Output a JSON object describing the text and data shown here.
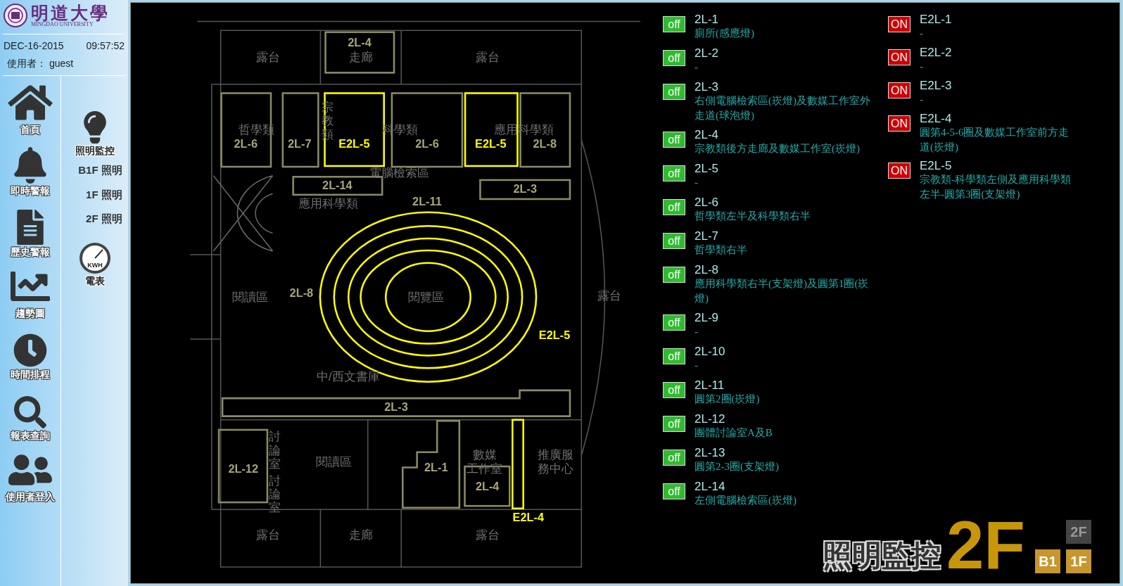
{
  "sidebar": {
    "logo_text": "明道大學",
    "logo_subtitle": "MINGDAO UNIVERSITY",
    "date": "DEC-16-2015",
    "time": "09:57:52",
    "user_label": "使用者：",
    "user": "guest",
    "nav": [
      {
        "label": "首頁",
        "kind": "home"
      },
      {
        "label": "即時警報",
        "kind": "alarm"
      },
      {
        "label": "歷史警報",
        "kind": "history"
      },
      {
        "label": "趨勢圖",
        "kind": "trend"
      },
      {
        "label": "時間排程",
        "kind": "schedule"
      },
      {
        "label": "報表查詢",
        "kind": "report"
      },
      {
        "label": "使用者登入",
        "kind": "users"
      }
    ],
    "lighting": {
      "title": "照明監控",
      "items": [
        "B1F 照明",
        "1F 照明",
        "2F 照明"
      ]
    },
    "meter": {
      "label": "電表",
      "dial": "KWH"
    }
  },
  "plan": {
    "rooms": [
      {
        "lines": [
          "露台"
        ],
        "kind": "h"
      },
      {
        "lines": [
          "走廊"
        ],
        "kind": "h"
      },
      {
        "lines": [
          "露台"
        ],
        "kind": "h"
      },
      {
        "lines": [
          "哲學類"
        ],
        "kind": "h"
      },
      {
        "lines": [
          "宗教類"
        ],
        "kind": "v"
      },
      {
        "lines": [
          "科學類"
        ],
        "kind": "h"
      },
      {
        "lines": [
          "應用科學類"
        ],
        "kind": "h"
      },
      {
        "lines": [
          "電腦檢索區"
        ],
        "kind": "h"
      },
      {
        "lines": [
          "應用科學類"
        ],
        "kind": "h"
      },
      {
        "lines": [
          "閱讀區"
        ],
        "kind": "h"
      },
      {
        "lines": [
          "閱覽區"
        ],
        "kind": "h"
      },
      {
        "lines": [
          "露台"
        ],
        "kind": "h"
      },
      {
        "lines": [
          "中/西文書庫"
        ],
        "kind": "h"
      },
      {
        "lines": [
          "討論室"
        ],
        "kind": "v"
      },
      {
        "lines": [
          "討論室"
        ],
        "kind": "v"
      },
      {
        "lines": [
          "閱讀區"
        ],
        "kind": "h"
      },
      {
        "lines": [
          "數媒",
          "工作室"
        ],
        "kind": "h"
      },
      {
        "lines": [
          "推廣服",
          "務中心"
        ],
        "kind": "h"
      },
      {
        "lines": [
          "露台"
        ],
        "kind": "h"
      },
      {
        "lines": [
          "走廊"
        ],
        "kind": "h"
      },
      {
        "lines": [
          "露台"
        ],
        "kind": "h"
      }
    ],
    "zones": [
      {
        "label": "2L-4",
        "lit": false
      },
      {
        "label": "2L-6",
        "lit": false
      },
      {
        "label": "2L-7",
        "lit": false
      },
      {
        "label": "E2L-5",
        "lit": true
      },
      {
        "label": "2L-6",
        "lit": false
      },
      {
        "label": "E2L-5",
        "lit": true
      },
      {
        "label": "2L-8",
        "lit": false
      },
      {
        "label": "2L-14",
        "lit": false
      },
      {
        "label": "2L-3",
        "lit": false
      },
      {
        "label": "2L-11",
        "lit": false
      },
      {
        "label": "2L-8",
        "lit": false
      },
      {
        "label": "E2L-5",
        "lit": true
      },
      {
        "label": "2L-3",
        "lit": false
      },
      {
        "label": "2L-12",
        "lit": false
      },
      {
        "label": "2L-1",
        "lit": false
      },
      {
        "label": "2L-4",
        "lit": false
      },
      {
        "label": "E2L-4",
        "lit": true
      }
    ],
    "rings": [
      {
        "lit": true
      },
      {
        "lit": true
      },
      {
        "lit": true
      },
      {
        "lit": true
      },
      {
        "lit": true
      }
    ]
  },
  "circuits": [
    [
      {
        "id": "2L-1",
        "description": "廁所(感應燈)",
        "status": "off",
        "on": false
      },
      {
        "id": "2L-2",
        "description": "-",
        "status": "off",
        "on": false
      },
      {
        "id": "2L-3",
        "description": "右側電腦檢索區(崁燈)及數媒工作室外走道(球泡燈)",
        "status": "off",
        "on": false
      },
      {
        "id": "2L-4",
        "description": "宗教類後方走廊及數媒工作室(崁燈)",
        "status": "off",
        "on": false
      },
      {
        "id": "2L-5",
        "description": "-",
        "status": "off",
        "on": false
      },
      {
        "id": "2L-6",
        "description": "哲學類左半及科學類右半",
        "status": "off",
        "on": false
      },
      {
        "id": "2L-7",
        "description": "哲學類右半",
        "status": "off",
        "on": false
      },
      {
        "id": "2L-8",
        "description": "應用科學類右半(支架燈)及圓第1圈(崁燈)",
        "status": "off",
        "on": false
      },
      {
        "id": "2L-9",
        "description": "-",
        "status": "off",
        "on": false
      },
      {
        "id": "2L-10",
        "description": "-",
        "status": "off",
        "on": false
      },
      {
        "id": "2L-11",
        "description": "圓第2圈(崁燈)",
        "status": "off",
        "on": false
      },
      {
        "id": "2L-12",
        "description": "團體討論室A及B",
        "status": "off",
        "on": false
      },
      {
        "id": "2L-13",
        "description": "圓第2-3圈(支架燈)",
        "status": "off",
        "on": false
      },
      {
        "id": "2L-14",
        "description": "左側電腦檢索區(崁燈)",
        "status": "off",
        "on": false
      }
    ],
    [
      {
        "id": "E2L-1",
        "description": "-",
        "status": "ON",
        "on": true
      },
      {
        "id": "E2L-2",
        "description": "-",
        "status": "ON",
        "on": true
      },
      {
        "id": "E2L-3",
        "description": "-",
        "status": "ON",
        "on": true
      },
      {
        "id": "E2L-4",
        "description": "圓第4-5-6圈及數媒工作室前方走道(崁燈)",
        "status": "ON",
        "on": true
      },
      {
        "id": "E2L-5",
        "description": "宗教類-科學類左側及應用科學類左半-圓第3圈(支架燈)",
        "status": "ON",
        "on": true
      }
    ]
  ],
  "footer": {
    "title": "照明監控",
    "floor": "2F",
    "floors": [
      {
        "label": "2F",
        "selected": true
      },
      {
        "label": "B1",
        "selected": false
      },
      {
        "label": "1F",
        "selected": false
      }
    ]
  }
}
